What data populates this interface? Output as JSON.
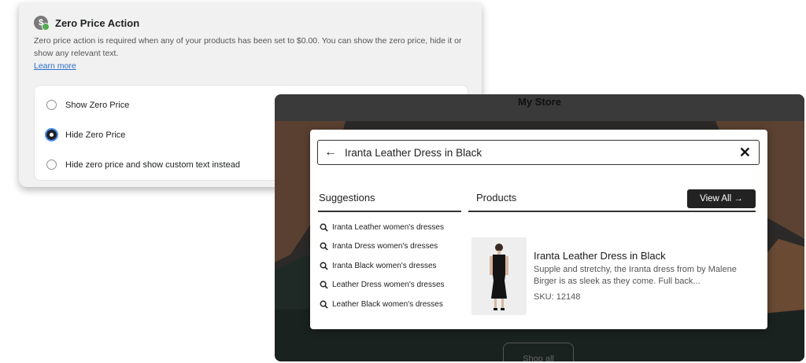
{
  "settings": {
    "title": "Zero Price Action",
    "description": "Zero price action is required when any of your products has been set to $0.00. You can show the zero price, hide it or show any relevant text.",
    "learn_more": "Learn more",
    "options": [
      {
        "label": "Show Zero Price",
        "selected": false
      },
      {
        "label": "Hide Zero Price",
        "selected": true
      },
      {
        "label": "Hide zero price and show custom text instead",
        "selected": false
      }
    ]
  },
  "store": {
    "title": "My Store",
    "shop_all": "Shop all"
  },
  "search": {
    "query": "Iranta Leather Dress in Black",
    "suggestions_header": "Suggestions",
    "products_header": "Products",
    "view_all": "View All →",
    "suggestions": [
      "Iranta Leather women's dresses",
      "Iranta Dress women's dresses",
      "Iranta Black women's dresses",
      "Leather Dress women's dresses",
      "Leather Black women's dresses"
    ],
    "product": {
      "name": "Iranta Leather Dress in Black",
      "description": "Supple and stretchy, the Iranta dress from by Malene Birger is as sleek as they come. Full back...",
      "sku": "SKU: 12148"
    }
  },
  "colors": {
    "accent_link": "#2c6ecb",
    "radio_focus": "#458fff",
    "dark_button": "#222222"
  }
}
